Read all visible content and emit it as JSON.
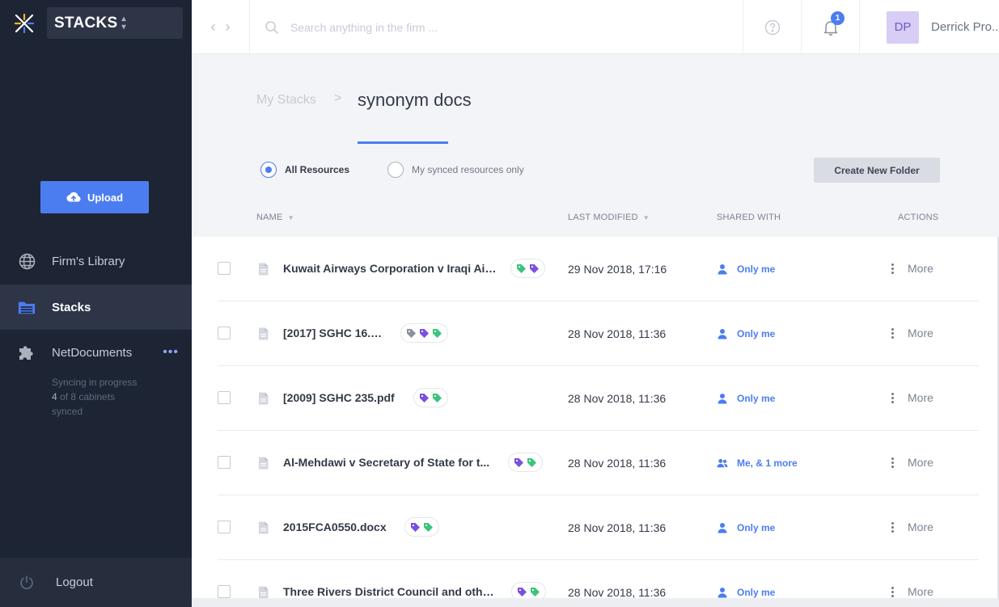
{
  "app": {
    "name": "STACKS",
    "logo": "stacks-logo"
  },
  "sidebar": {
    "upload_label": "Upload",
    "items": [
      {
        "label": "Firm's Library",
        "icon": "globe-icon"
      },
      {
        "label": "Stacks",
        "icon": "folder-stack-icon",
        "active": true
      },
      {
        "label": "NetDocuments",
        "icon": "puzzle-icon"
      }
    ],
    "sync": {
      "line1": "Syncing in progress",
      "count": "4",
      "line2_rest": " of 8 cabinets",
      "line3": "synced"
    },
    "logout_label": "Logout"
  },
  "topbar": {
    "search_placeholder": "Search anything in the firm ...",
    "notifications_count": "1",
    "user_initials": "DP",
    "user_name": "Derrick Pro..."
  },
  "breadcrumb": {
    "parent": "My Stacks",
    "separator": ">",
    "current": "synonym docs"
  },
  "filters": {
    "all_label": "All Resources",
    "synced_label": "My synced resources only",
    "selected": "all"
  },
  "create_folder_label": "Create New Folder",
  "columns": {
    "name": "NAME",
    "modified": "LAST MODIFIED",
    "shared": "SHARED WITH",
    "actions": "ACTIONS"
  },
  "colors": {
    "accent": "#4c7df0",
    "sidebar_bg": "#1d2433",
    "tag_green": "#3cc47c",
    "tag_purple": "#7b4fe0",
    "tag_gray": "#8a919e"
  },
  "rows": [
    {
      "name": "Kuwait Airways Corporation v Iraqi Air...",
      "tags": [
        "green",
        "purple"
      ],
      "modified": "29 Nov 2018, 17:16",
      "shared": "Only me",
      "shared_type": "single",
      "action": "More"
    },
    {
      "name": "[2017] SGHC 16.pdf",
      "tags": [
        "gray",
        "purple",
        "green"
      ],
      "modified": "28 Nov 2018, 11:36",
      "shared": "Only me",
      "shared_type": "single",
      "action": "More"
    },
    {
      "name": "[2009] SGHC 235.pdf",
      "tags": [
        "purple",
        "green"
      ],
      "modified": "28 Nov 2018, 11:36",
      "shared": "Only me",
      "shared_type": "single",
      "action": "More"
    },
    {
      "name": "Al-Mehdawi v Secretary of State for t...",
      "tags": [
        "purple",
        "green"
      ],
      "modified": "28 Nov 2018, 11:36",
      "shared": "Me,  & 1 more",
      "shared_type": "group",
      "action": "More"
    },
    {
      "name": "2015FCA0550.docx",
      "tags": [
        "purple",
        "green"
      ],
      "modified": "28 Nov 2018, 11:36",
      "shared": "Only me",
      "shared_type": "single",
      "action": "More"
    },
    {
      "name": "Three Rivers District Council and othe...",
      "tags": [
        "purple",
        "green"
      ],
      "modified": "28 Nov 2018, 11:36",
      "shared": "Only me",
      "shared_type": "single",
      "action": "More"
    }
  ]
}
